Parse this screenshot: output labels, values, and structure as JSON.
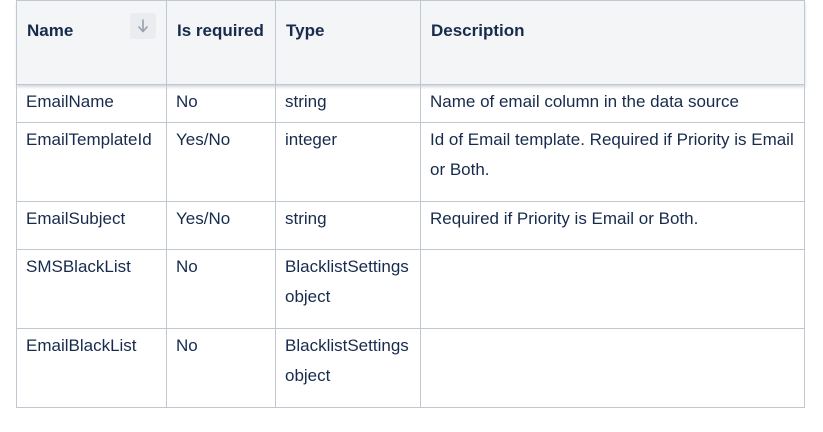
{
  "table": {
    "headers": {
      "name": "Name",
      "required": "Is required",
      "type": "Type",
      "description": "Description"
    },
    "sort_icon": "arrow-down-icon",
    "rows": [
      {
        "name": "EmailName",
        "required": "No",
        "type": "string",
        "description": "Name of email column in the data source"
      },
      {
        "name": "EmailTemplateId",
        "required": "Yes/No",
        "type": "integer",
        "description": "Id of Email template. Required if Priority is Email or Both."
      },
      {
        "name": "EmailSubject",
        "required": "Yes/No",
        "type": "string",
        "description": "Required if Priority is Email or Both."
      },
      {
        "name": "SMSBlackList",
        "required": "No",
        "type": "BlacklistSettings object",
        "description": ""
      },
      {
        "name": "EmailBlackList",
        "required": "No",
        "type": "BlacklistSettings object",
        "description": ""
      }
    ]
  }
}
